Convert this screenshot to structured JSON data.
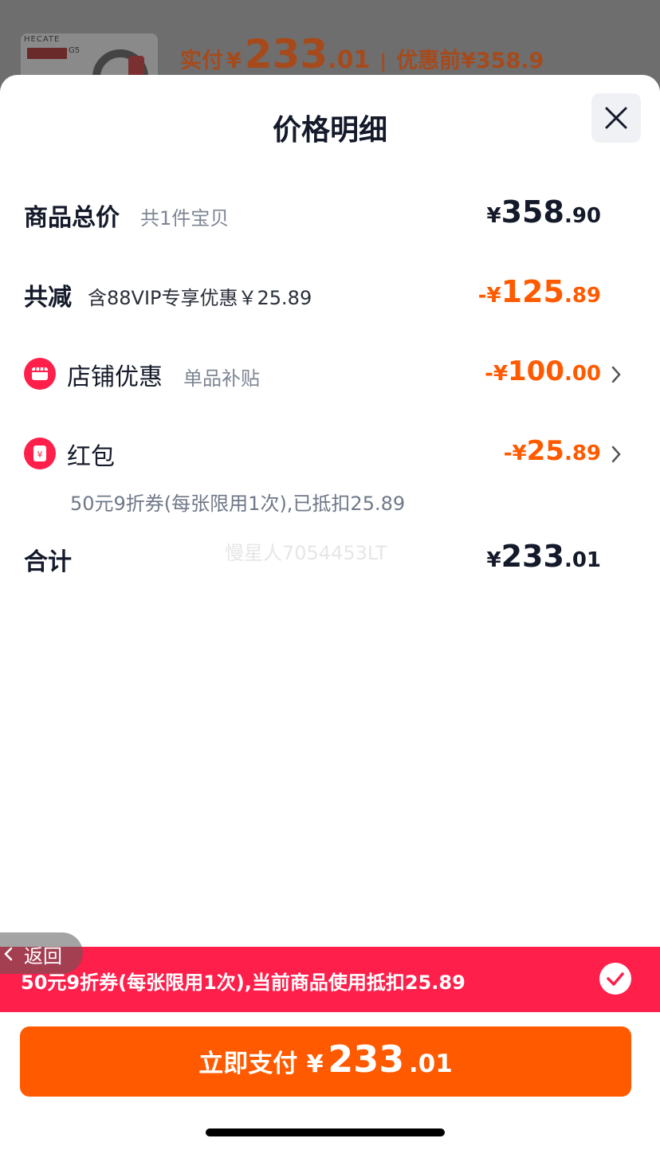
{
  "background": {
    "product_brand": "HECATE",
    "product_model": "G5",
    "price_summary": {
      "paid_label": "实付",
      "currency": "¥",
      "paid_int": "233",
      "paid_dec": ".01",
      "separator": "|",
      "original_label": "优惠前",
      "original_price": "¥358.9"
    }
  },
  "sheet": {
    "title": "价格明细",
    "close_icon": "close-icon",
    "rows": {
      "total_goods": {
        "label": "商品总价",
        "sub": "共1件宝贝",
        "yen": "¥",
        "int": "358",
        "dec": ".90"
      },
      "total_discount": {
        "label": "共减",
        "sub": "含88VIP专享优惠￥25.89",
        "sign": "-",
        "yen": "¥",
        "int": "125",
        "dec": ".89"
      },
      "store_discount": {
        "label": "店铺优惠",
        "sub": "单品补贴",
        "sign": "-",
        "yen": "¥",
        "int": "100",
        "dec": ".00",
        "icon": "shop-icon"
      },
      "red_packet": {
        "label": "红包",
        "sign": "-",
        "yen": "¥",
        "int": "25",
        "dec": ".89",
        "icon": "red-packet-icon",
        "note": "50元9折券(每张限用1次),已抵扣25.89"
      },
      "subtotal": {
        "label": "合计",
        "yen": "¥",
        "int": "233",
        "dec": ".01"
      }
    },
    "watermark": "慢星人7054453LT"
  },
  "banner": {
    "text": "50元9折券(每张限用1次),当前商品使用抵扣25.89",
    "check_icon": "check-icon"
  },
  "back": {
    "label": "返回"
  },
  "pay_button": {
    "label": "立即支付",
    "yen": "¥",
    "int": "233",
    "dec": ".01"
  },
  "colors": {
    "accent_orange": "#ff5a00",
    "accent_red": "#ff1f4b",
    "text_dark": "#141a2a"
  }
}
